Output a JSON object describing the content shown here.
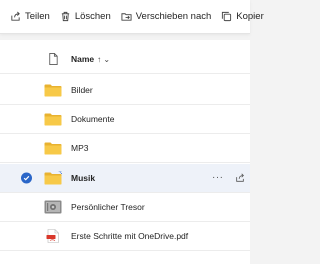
{
  "toolbar": {
    "share_label": "Teilen",
    "delete_label": "Löschen",
    "move_label": "Verschieben nach",
    "copy_label": "Kopier"
  },
  "list": {
    "header": {
      "name_label": "Name",
      "sort_indicator": "↑ ⌄"
    },
    "items": [
      {
        "label": "Bilder",
        "icon": "folder-icon",
        "selected": false
      },
      {
        "label": "Dokumente",
        "icon": "folder-icon",
        "selected": false
      },
      {
        "label": "MP3",
        "icon": "folder-icon",
        "selected": false
      },
      {
        "label": "Musik",
        "icon": "folder-icon",
        "selected": true
      },
      {
        "label": "Persönlicher Tresor",
        "icon": "vault-icon",
        "selected": false
      },
      {
        "label": "Erste Schritte mit OneDrive.pdf",
        "icon": "pdf-icon",
        "selected": false
      }
    ],
    "row_more": "···"
  },
  "colors": {
    "folder": "#f7c948",
    "folder_dark": "#e8b230",
    "accent": "#2a66c8",
    "pdf_red": "#d9372b"
  }
}
